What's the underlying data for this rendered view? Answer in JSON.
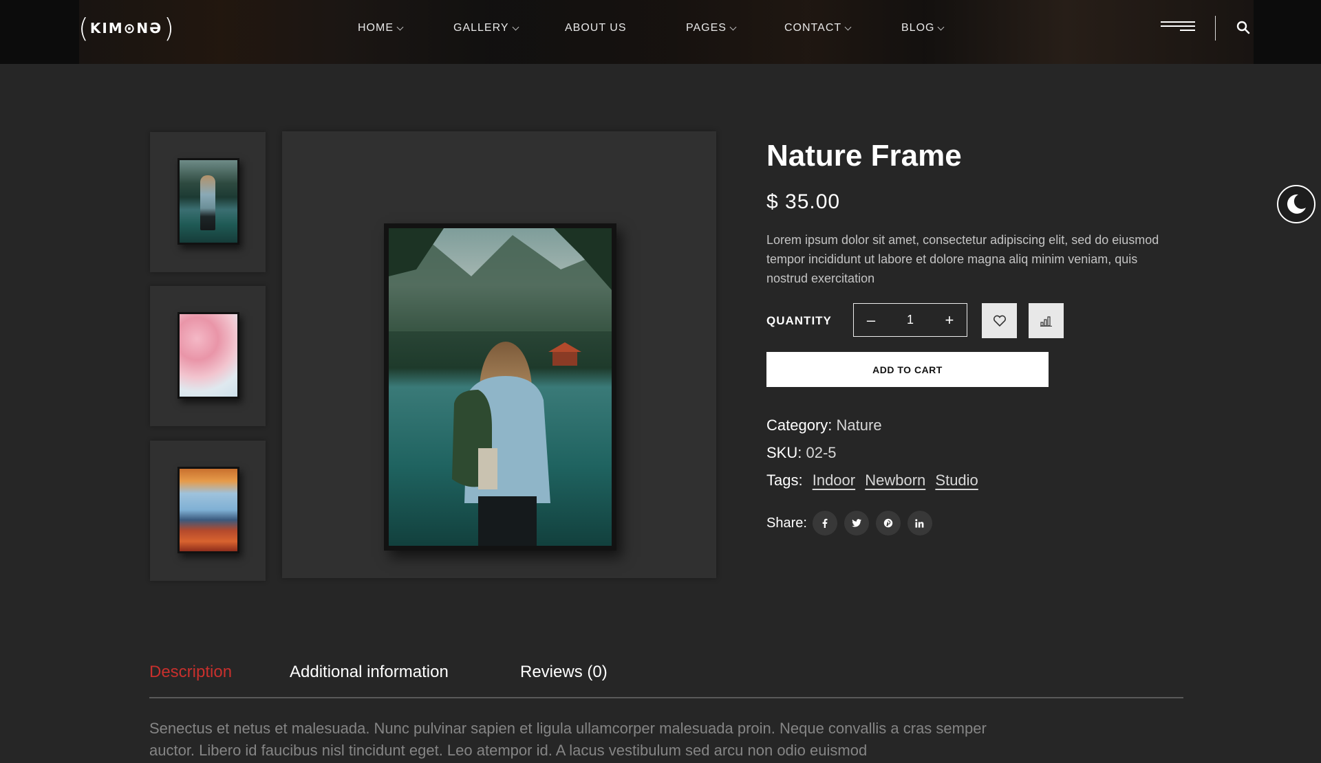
{
  "header": {
    "logo_text": "KIM⊙NƏ",
    "nav": [
      {
        "label": "HOME",
        "has_dropdown": true
      },
      {
        "label": "GALLERY",
        "has_dropdown": true
      },
      {
        "label": "ABOUT US",
        "has_dropdown": false
      },
      {
        "label": "PAGES",
        "has_dropdown": true
      },
      {
        "label": "CONTACT",
        "has_dropdown": true
      },
      {
        "label": "BLOG",
        "has_dropdown": true
      }
    ],
    "menu_icon": "hamburger-icon",
    "search_icon": "search-icon"
  },
  "gallery": {
    "thumbnails": [
      {
        "name": "hiker-lake",
        "selected": true
      },
      {
        "name": "cherry-blossom"
      },
      {
        "name": "autumn-mountain"
      }
    ]
  },
  "product": {
    "title": "Nature Frame",
    "price": "$ 35.00",
    "description": "Lorem ipsum dolor sit amet, consectetur adipiscing elit, sed do eiusmod tempor incididunt ut labore et dolore magna aliq minim veniam, quis nostrud exercitation",
    "quantity_label": "QUANTITY",
    "quantity": {
      "minus": "–",
      "value": "1",
      "plus": "+"
    },
    "wishlist_icon": "heart-icon",
    "compare_icon": "compare-bars-icon",
    "add_to_cart": "ADD TO CART",
    "category_label": "Category:",
    "category": "Nature",
    "sku_label": "SKU:",
    "sku": "02-5",
    "tags_label": "Tags:",
    "tags": [
      "Indoor",
      "Newborn",
      "Studio"
    ],
    "share_label": "Share:",
    "share": [
      {
        "icon": "facebook-icon",
        "glyph": "f"
      },
      {
        "icon": "twitter-icon",
        "glyph": "t"
      },
      {
        "icon": "pinterest-icon",
        "glyph": "p"
      },
      {
        "icon": "linkedin-icon",
        "glyph": "in"
      }
    ]
  },
  "theme_toggle_icon": "moon-icon",
  "tabs": {
    "items": [
      {
        "label": "Description",
        "active": true
      },
      {
        "label": "Additional information",
        "active": false
      },
      {
        "label": "Reviews (0)",
        "active": false
      }
    ],
    "description_text": "Senectus et netus et malesuada. Nunc pulvinar sapien et ligula ullamcorper malesuada proin. Neque convallis a cras semper auctor. Libero id faucibus nisl tincidunt eget. Leo atempor id. A lacus vestibulum sed arcu non odio euismod"
  },
  "colors": {
    "background": "#262626",
    "header": "#0c0c0c",
    "accent_active_tab": "#c8302d",
    "button_light": "#ffffff"
  }
}
